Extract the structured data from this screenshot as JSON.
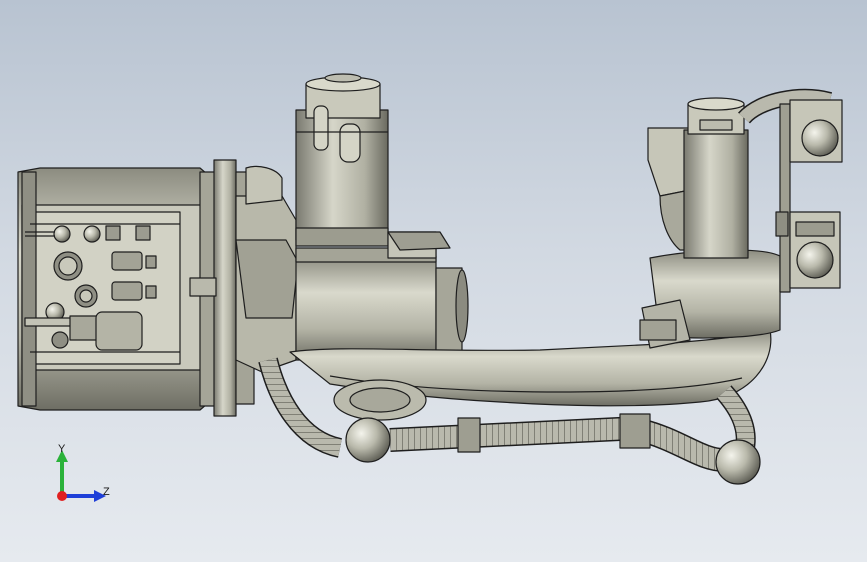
{
  "viewport": {
    "background_top": "#b8c3d1",
    "background_bottom": "#e6eaef"
  },
  "model": {
    "name": "robot-wrist-assembly",
    "body_color": "#b5b5a7",
    "outline_color": "#1e1e1e"
  },
  "triad": {
    "y_label": "Y",
    "z_label": "Z",
    "y_color": "#2bb23a",
    "z_color": "#1e3fd8",
    "x_color": "#e02020"
  }
}
